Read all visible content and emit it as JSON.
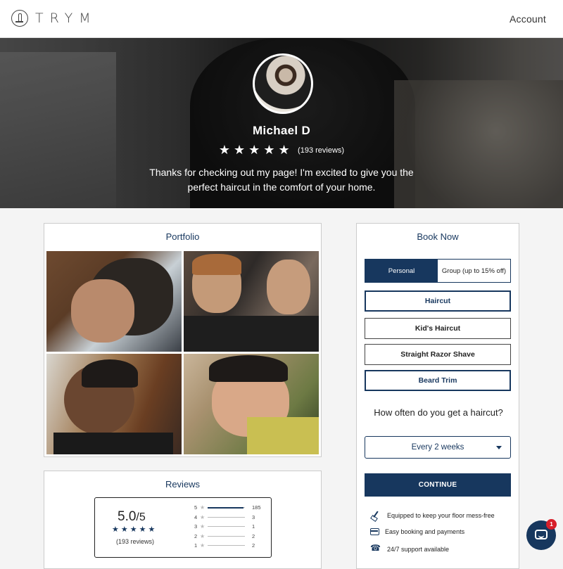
{
  "header": {
    "logo_text": "TRYM",
    "account_label": "Account"
  },
  "profile": {
    "name": "Michael D",
    "stars": "★★★★★",
    "review_count": "(193 reviews)",
    "tagline": "Thanks for checking out my page! I'm excited to give you the perfect haircut in the comfort of your home."
  },
  "portfolio": {
    "title": "Portfolio"
  },
  "reviews": {
    "title": "Reviews",
    "average": "5.0",
    "out_of": "/5",
    "stars": "★★★★★",
    "count": "(193 reviews)",
    "distribution": [
      {
        "level": "5",
        "count": "185",
        "fraction": 0.96
      },
      {
        "level": "4",
        "count": "3",
        "fraction": 0
      },
      {
        "level": "3",
        "count": "1",
        "fraction": 0
      },
      {
        "level": "2",
        "count": "2",
        "fraction": 0
      },
      {
        "level": "1",
        "count": "2",
        "fraction": 0
      }
    ]
  },
  "booking": {
    "title": "Book Now",
    "tabs": [
      {
        "label": "Personal",
        "selected": true
      },
      {
        "label": "Group (up to 15% off)",
        "selected": false
      }
    ],
    "services": [
      {
        "label": "Haircut",
        "selected": true
      },
      {
        "label": "Kid's Haircut",
        "selected": false
      },
      {
        "label": "Straight Razor Shave",
        "selected": false
      },
      {
        "label": "Beard Trim",
        "selected": true
      }
    ],
    "question": "How often do you get a haircut?",
    "frequency_value": "Every 2 weeks",
    "continue_label": "CONTINUE",
    "features": [
      {
        "icon": "broom-icon",
        "text": "Equipped to keep your floor mess-free"
      },
      {
        "icon": "credit-card-icon",
        "text": "Easy booking and payments"
      },
      {
        "icon": "phone-icon",
        "text": "24/7 support available"
      }
    ]
  },
  "chat": {
    "badge_count": "1"
  },
  "colors": {
    "primary": "#17375e",
    "badge": "#d71f2a"
  }
}
